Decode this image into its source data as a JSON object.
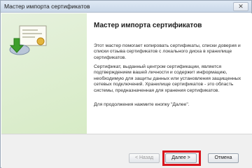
{
  "window": {
    "title": "Мастер импорта сертификатов",
    "close_label": "✕"
  },
  "content": {
    "heading": "Мастер импорта сертификатов",
    "paragraph1": "Этот мастер помогает копировать сертификаты, списки доверия и списки отзыва сертификатов с локального диска в хранилище сертификатов.",
    "paragraph2": "Сертификат, выданный центром сертификации, является подтверждением вашей личности и содержит информацию, необходимую для защиты данных или установления защищенных сетевых подключений. Хранилище сертификатов - это область системы, предназначенная для хранения сертификатов.",
    "paragraph3": "Для продолжения нажмите кнопку \"Далее\"."
  },
  "buttons": {
    "back": "< Назад",
    "next": "Далее >",
    "cancel": "Отмена"
  },
  "colors": {
    "banner": "#d7ebc6",
    "highlight": "#d7141c"
  },
  "icons": {
    "wizard": "certificate-import-icon"
  }
}
